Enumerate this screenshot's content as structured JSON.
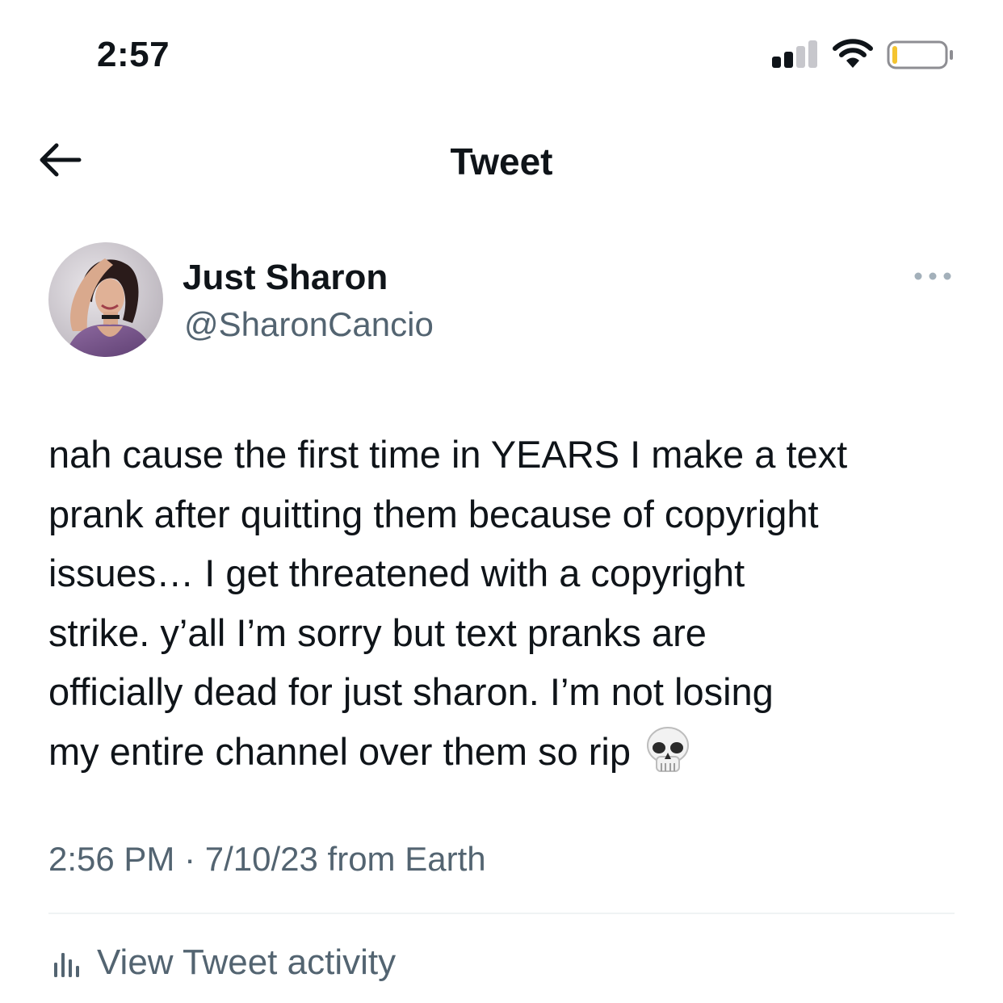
{
  "status_bar": {
    "time": "2:57",
    "signal_bars_active": 2,
    "signal_bars_total": 4,
    "wifi_icon": "wifi-icon",
    "battery_level": 0.1,
    "battery_color": "#f4c430"
  },
  "nav": {
    "back_icon": "back-arrow-icon",
    "title": "Tweet"
  },
  "tweet": {
    "author": {
      "display_name": "Just Sharon",
      "handle": "@SharonCancio",
      "avatar_icon": "avatar-photo"
    },
    "more_icon": "more-options-icon",
    "text": "nah cause the first time in YEARS I make a text\nprank after quitting them because of copyright\nissues… I get threatened with a copyright\nstrike. y’all I’m sorry but text pranks are\nofficially dead for just sharon. I’m not losing\nmy entire channel over them so rip",
    "emoji": "skull-emoji",
    "meta": "2:56 PM · 7/10/23 from Earth",
    "activity_icon": "analytics-icon",
    "activity_label": "View Tweet activity"
  },
  "colors": {
    "text_primary": "#0f1419",
    "text_secondary": "#536471",
    "divider": "#eff3f4"
  }
}
